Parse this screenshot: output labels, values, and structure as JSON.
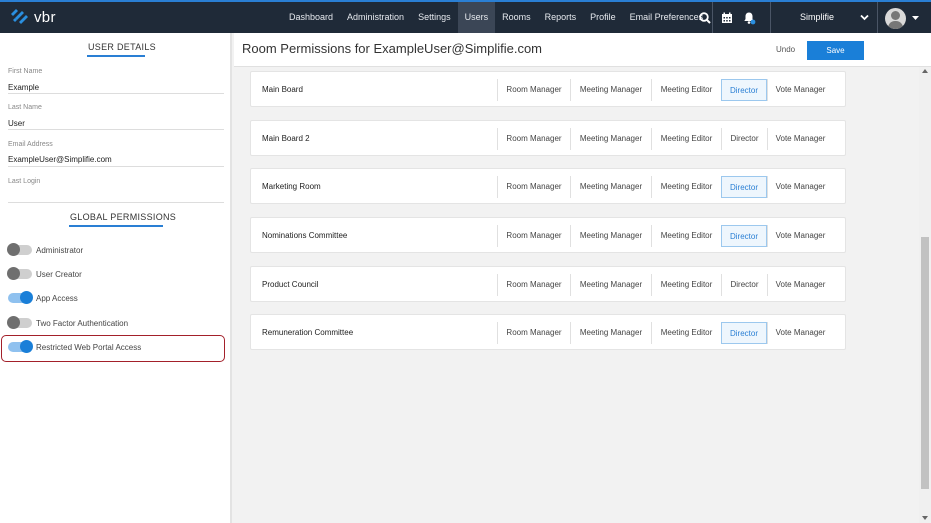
{
  "app": {
    "logo_text": "vbr",
    "org_name": "Simplifie"
  },
  "nav": {
    "items": [
      {
        "label": "Dashboard",
        "active": false
      },
      {
        "label": "Administration",
        "active": false
      },
      {
        "label": "Settings",
        "active": false
      },
      {
        "label": "Users",
        "active": true
      },
      {
        "label": "Rooms",
        "active": false
      },
      {
        "label": "Reports",
        "active": false
      },
      {
        "label": "Profile",
        "active": false
      },
      {
        "label": "Email Preferences",
        "active": false
      }
    ],
    "icons": [
      "search-icon",
      "calendar-icon",
      "notification-bell-icon"
    ]
  },
  "user_details": {
    "title": "USER DETAILS",
    "first_name_label": "First Name",
    "first_name": "Example",
    "last_name_label": "Last Name",
    "last_name": "User",
    "email_label": "Email Address",
    "email": "ExampleUser@Simplifie.com",
    "last_login_label": "Last Login"
  },
  "global_permissions": {
    "title": "GLOBAL PERMISSIONS",
    "items": [
      {
        "label": "Administrator",
        "enabled": false
      },
      {
        "label": "User Creator",
        "enabled": false
      },
      {
        "label": "App Access",
        "enabled": true
      },
      {
        "label": "Two Factor Authentication",
        "enabled": false
      },
      {
        "label": "Restricted Web Portal Access",
        "enabled": true
      }
    ]
  },
  "main": {
    "title": "Room Permissions for ExampleUser@Simplifie.com",
    "undo_label": "Undo",
    "save_label": "Save"
  },
  "role_labels": [
    "Room Manager",
    "Meeting Manager",
    "Meeting Editor",
    "Director",
    "Vote Manager"
  ],
  "rooms": [
    {
      "name": "Main Board",
      "selected_role": "Director"
    },
    {
      "name": "Main Board 2",
      "selected_role": null
    },
    {
      "name": "Marketing Room",
      "selected_role": "Director"
    },
    {
      "name": "Nominations Committee",
      "selected_role": "Director"
    },
    {
      "name": "Product Council",
      "selected_role": null
    },
    {
      "name": "Remuneration Committee",
      "selected_role": "Director"
    }
  ],
  "colors": {
    "accent": "#1a7fd8",
    "topbar": "#1f2a38",
    "highlight_border": "#a3202a"
  }
}
